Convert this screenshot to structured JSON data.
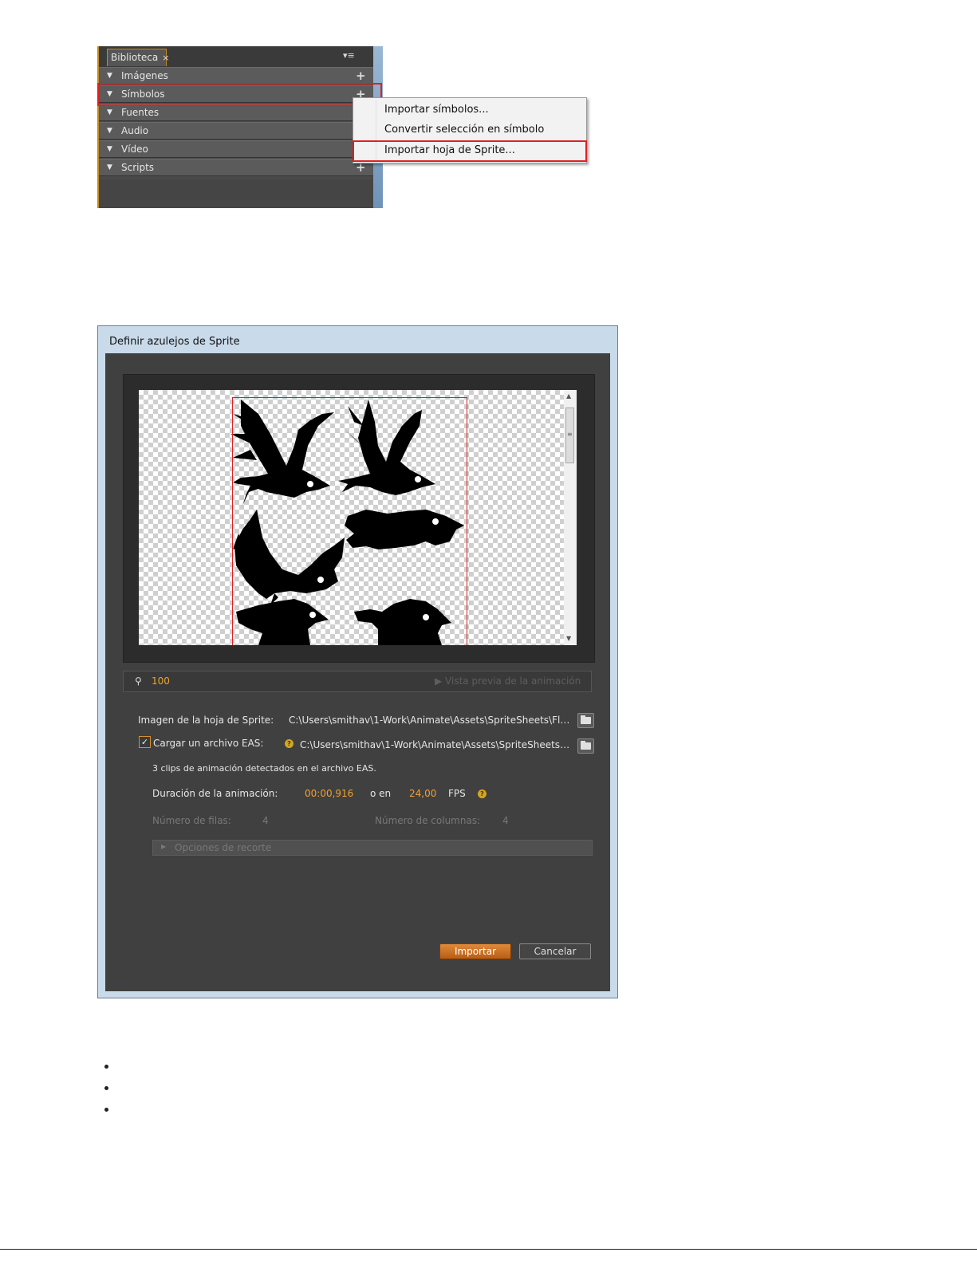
{
  "library": {
    "tab_label": "Biblioteca",
    "tab_close": "×",
    "panel_menu": "▾≡",
    "rows": [
      {
        "label": "Imágenes",
        "plus": "+"
      },
      {
        "label": "Símbolos",
        "plus": "+"
      },
      {
        "label": "Fuentes",
        "plus": ""
      },
      {
        "label": "Audio",
        "plus": ""
      },
      {
        "label": "Vídeo",
        "plus": ""
      },
      {
        "label": "Scripts",
        "plus": "+"
      }
    ]
  },
  "context_menu": {
    "items": [
      "Importar símbolos...",
      "Convertir selección en símbolo",
      "Importar hoja de Sprite..."
    ]
  },
  "dialog": {
    "title": "Definir azulejos de Sprite",
    "zoom": "100",
    "preview_label": "Vista previa de la animación",
    "sprite_image_label": "Imagen de la hoja de Sprite:",
    "sprite_image_path": "C:\\Users\\smithav\\1-Work\\Animate\\Assets\\SpriteSheets\\Flash...",
    "eas_checkbox_label": "Cargar un archivo EAS:",
    "eas_checked": true,
    "eas_path": "C:\\Users\\smithav\\1-Work\\Animate\\Assets\\SpriteSheets\\Fl...",
    "eas_info": "3 clips de animación detectados en el archivo EAS.",
    "duration_label": "Duración de la animación:",
    "duration_value": "00:00,916",
    "or_in": "o en",
    "fps_value": "24,00",
    "fps_label": "FPS",
    "rows_label": "Número de filas:",
    "rows_value": "4",
    "cols_label": "Número de columnas:",
    "cols_value": "4",
    "crop_options": "Opciones de recorte",
    "import_button": "Importar",
    "cancel_button": "Cancelar"
  },
  "colors": {
    "accent_orange": "#f0a030",
    "highlight_red": "#e02020",
    "dialog_bg": "#404040"
  }
}
